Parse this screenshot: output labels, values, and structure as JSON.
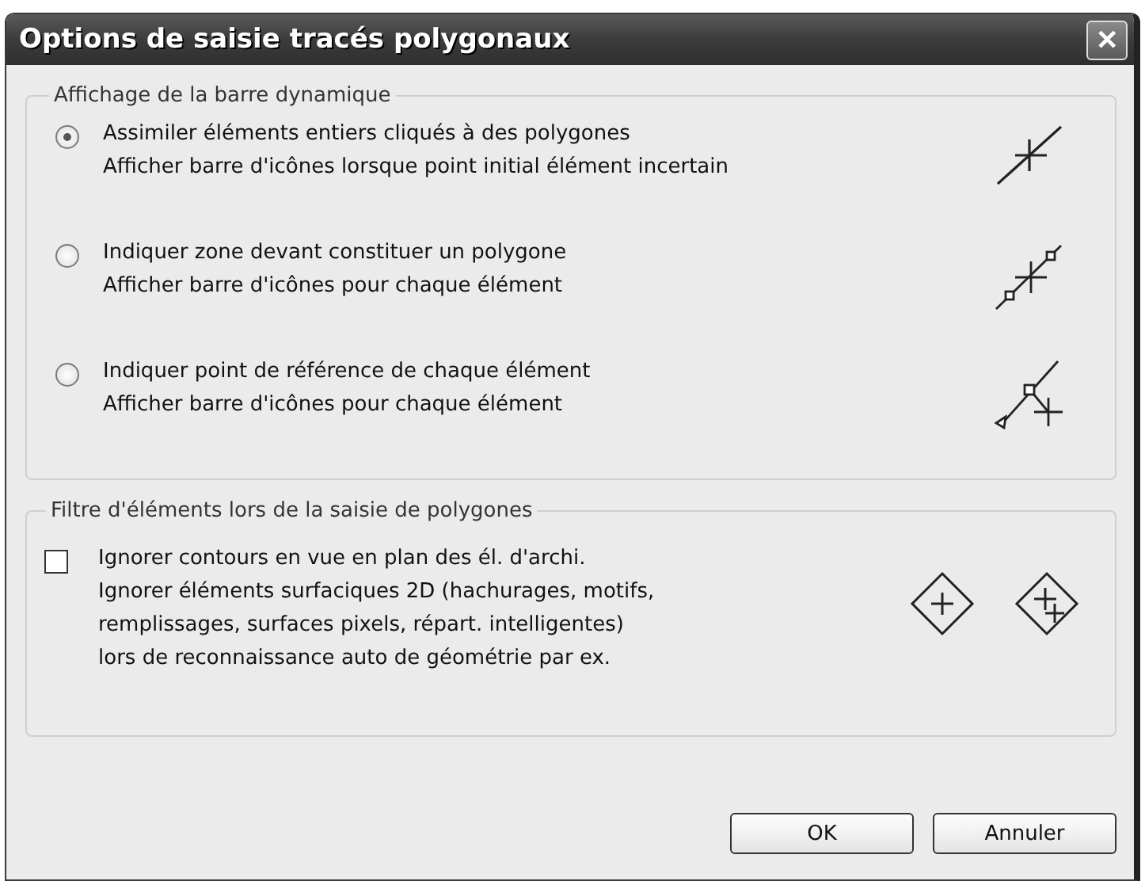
{
  "window": {
    "title": "Options de saisie tracés polygonaux",
    "close": "✕"
  },
  "dynamic_bar": {
    "legend": "Affichage de la barre dynamique",
    "options": [
      {
        "label": "Assimiler éléments entiers cliqués à des polygones",
        "description": "Afficher barre d'icônes lorsque point initial élément incertain",
        "selected": true
      },
      {
        "label": "Indiquer zone devant constituer un polygone",
        "description": "Afficher barre d'icônes pour chaque élément",
        "selected": false
      },
      {
        "label": "Indiquer point de référence de chaque élément",
        "description": "Afficher barre d'icônes pour chaque élément",
        "selected": false
      }
    ]
  },
  "filter": {
    "legend": "Filtre d'éléments lors de la saisie de polygones",
    "checkbox": {
      "label": "Ignorer contours en vue en plan des él. d'archi.",
      "checked": false,
      "description_lines": [
        "Ignorer éléments surfaciques 2D (hachurages, motifs,",
        "remplissages, surfaces pixels, répart. intelligentes)",
        "lors de reconnaissance auto de géométrie par ex."
      ]
    }
  },
  "buttons": [
    "OK",
    "Annuler"
  ]
}
